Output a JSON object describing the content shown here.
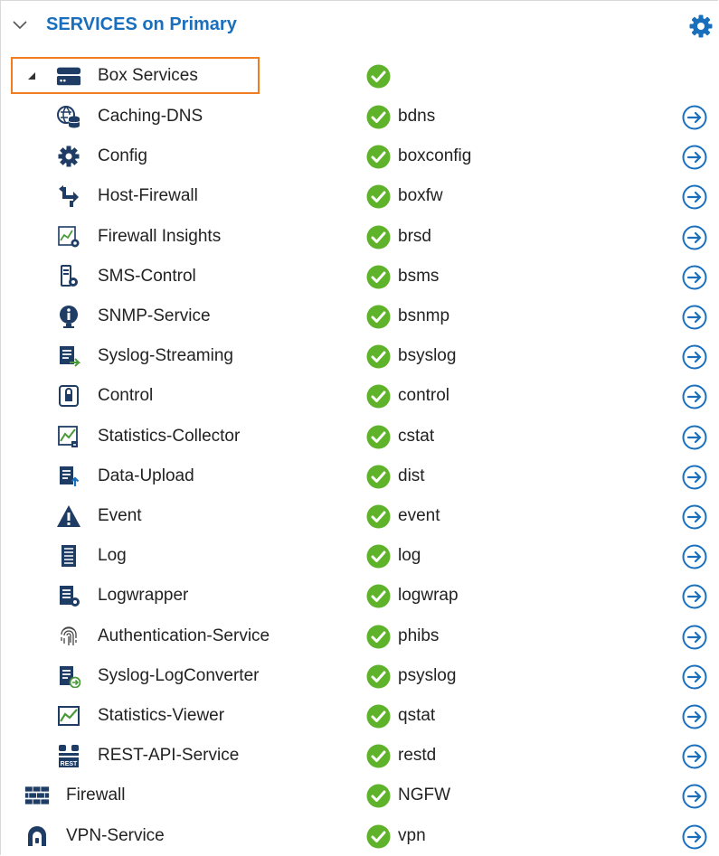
{
  "header": {
    "title": "SERVICES on Primary"
  },
  "colors": {
    "accent": "#1a6fbd",
    "ok": "#5fb32a",
    "highlight": "#f07d22",
    "icon": "#1e3c64"
  },
  "box": {
    "label": "Box Services"
  },
  "services": [
    {
      "label": "Caching-DNS",
      "code": "bdns",
      "icon": "dns-database-icon"
    },
    {
      "label": "Config",
      "code": "boxconfig",
      "icon": "gear-icon"
    },
    {
      "label": "Host-Firewall",
      "code": "boxfw",
      "icon": "host-firewall-arrows-icon"
    },
    {
      "label": "Firewall Insights",
      "code": "brsd",
      "icon": "insights-chart-icon"
    },
    {
      "label": "SMS-Control",
      "code": "bsms",
      "icon": "sms-control-icon"
    },
    {
      "label": "SNMP-Service",
      "code": "bsnmp",
      "icon": "info-icon"
    },
    {
      "label": "Syslog-Streaming",
      "code": "bsyslog",
      "icon": "syslog-stream-icon"
    },
    {
      "label": "Control",
      "code": "control",
      "icon": "lock-control-icon"
    },
    {
      "label": "Statistics-Collector",
      "code": "cstat",
      "icon": "stats-collector-icon"
    },
    {
      "label": "Data-Upload",
      "code": "dist",
      "icon": "upload-document-icon"
    },
    {
      "label": "Event",
      "code": "event",
      "icon": "warning-icon"
    },
    {
      "label": "Log",
      "code": "log",
      "icon": "log-document-icon"
    },
    {
      "label": "Logwrapper",
      "code": "logwrap",
      "icon": "logwrapper-icon"
    },
    {
      "label": "Authentication-Service",
      "code": "phibs",
      "icon": "fingerprint-icon"
    },
    {
      "label": "Syslog-LogConverter",
      "code": "psyslog",
      "icon": "syslog-converter-icon"
    },
    {
      "label": "Statistics-Viewer",
      "code": "qstat",
      "icon": "stats-viewer-icon"
    },
    {
      "label": "REST-API-Service",
      "code": "restd",
      "icon": "rest-api-icon"
    }
  ],
  "top_services": [
    {
      "label": "Firewall",
      "code": "NGFW",
      "icon": "brick-wall-icon"
    },
    {
      "label": "VPN-Service",
      "code": "vpn",
      "icon": "vpn-tunnel-icon"
    }
  ],
  "rest_badge": "REST"
}
